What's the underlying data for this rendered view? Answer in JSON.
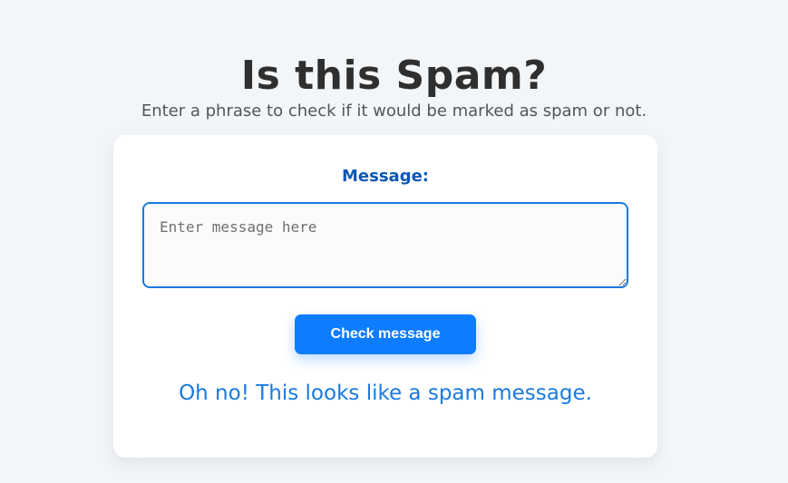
{
  "header": {
    "title": "Is this Spam?",
    "subtitle": "Enter a phrase to check if it would be marked as spam or not."
  },
  "form": {
    "label": "Message:",
    "textarea_placeholder": "Enter message here",
    "button_label": "Check message",
    "result_text": "Oh no! This looks like a spam message."
  },
  "colors": {
    "accent": "#0d7cff",
    "label": "#0d57b5",
    "result": "#1a7ae0",
    "background": "#f3f6f9"
  }
}
